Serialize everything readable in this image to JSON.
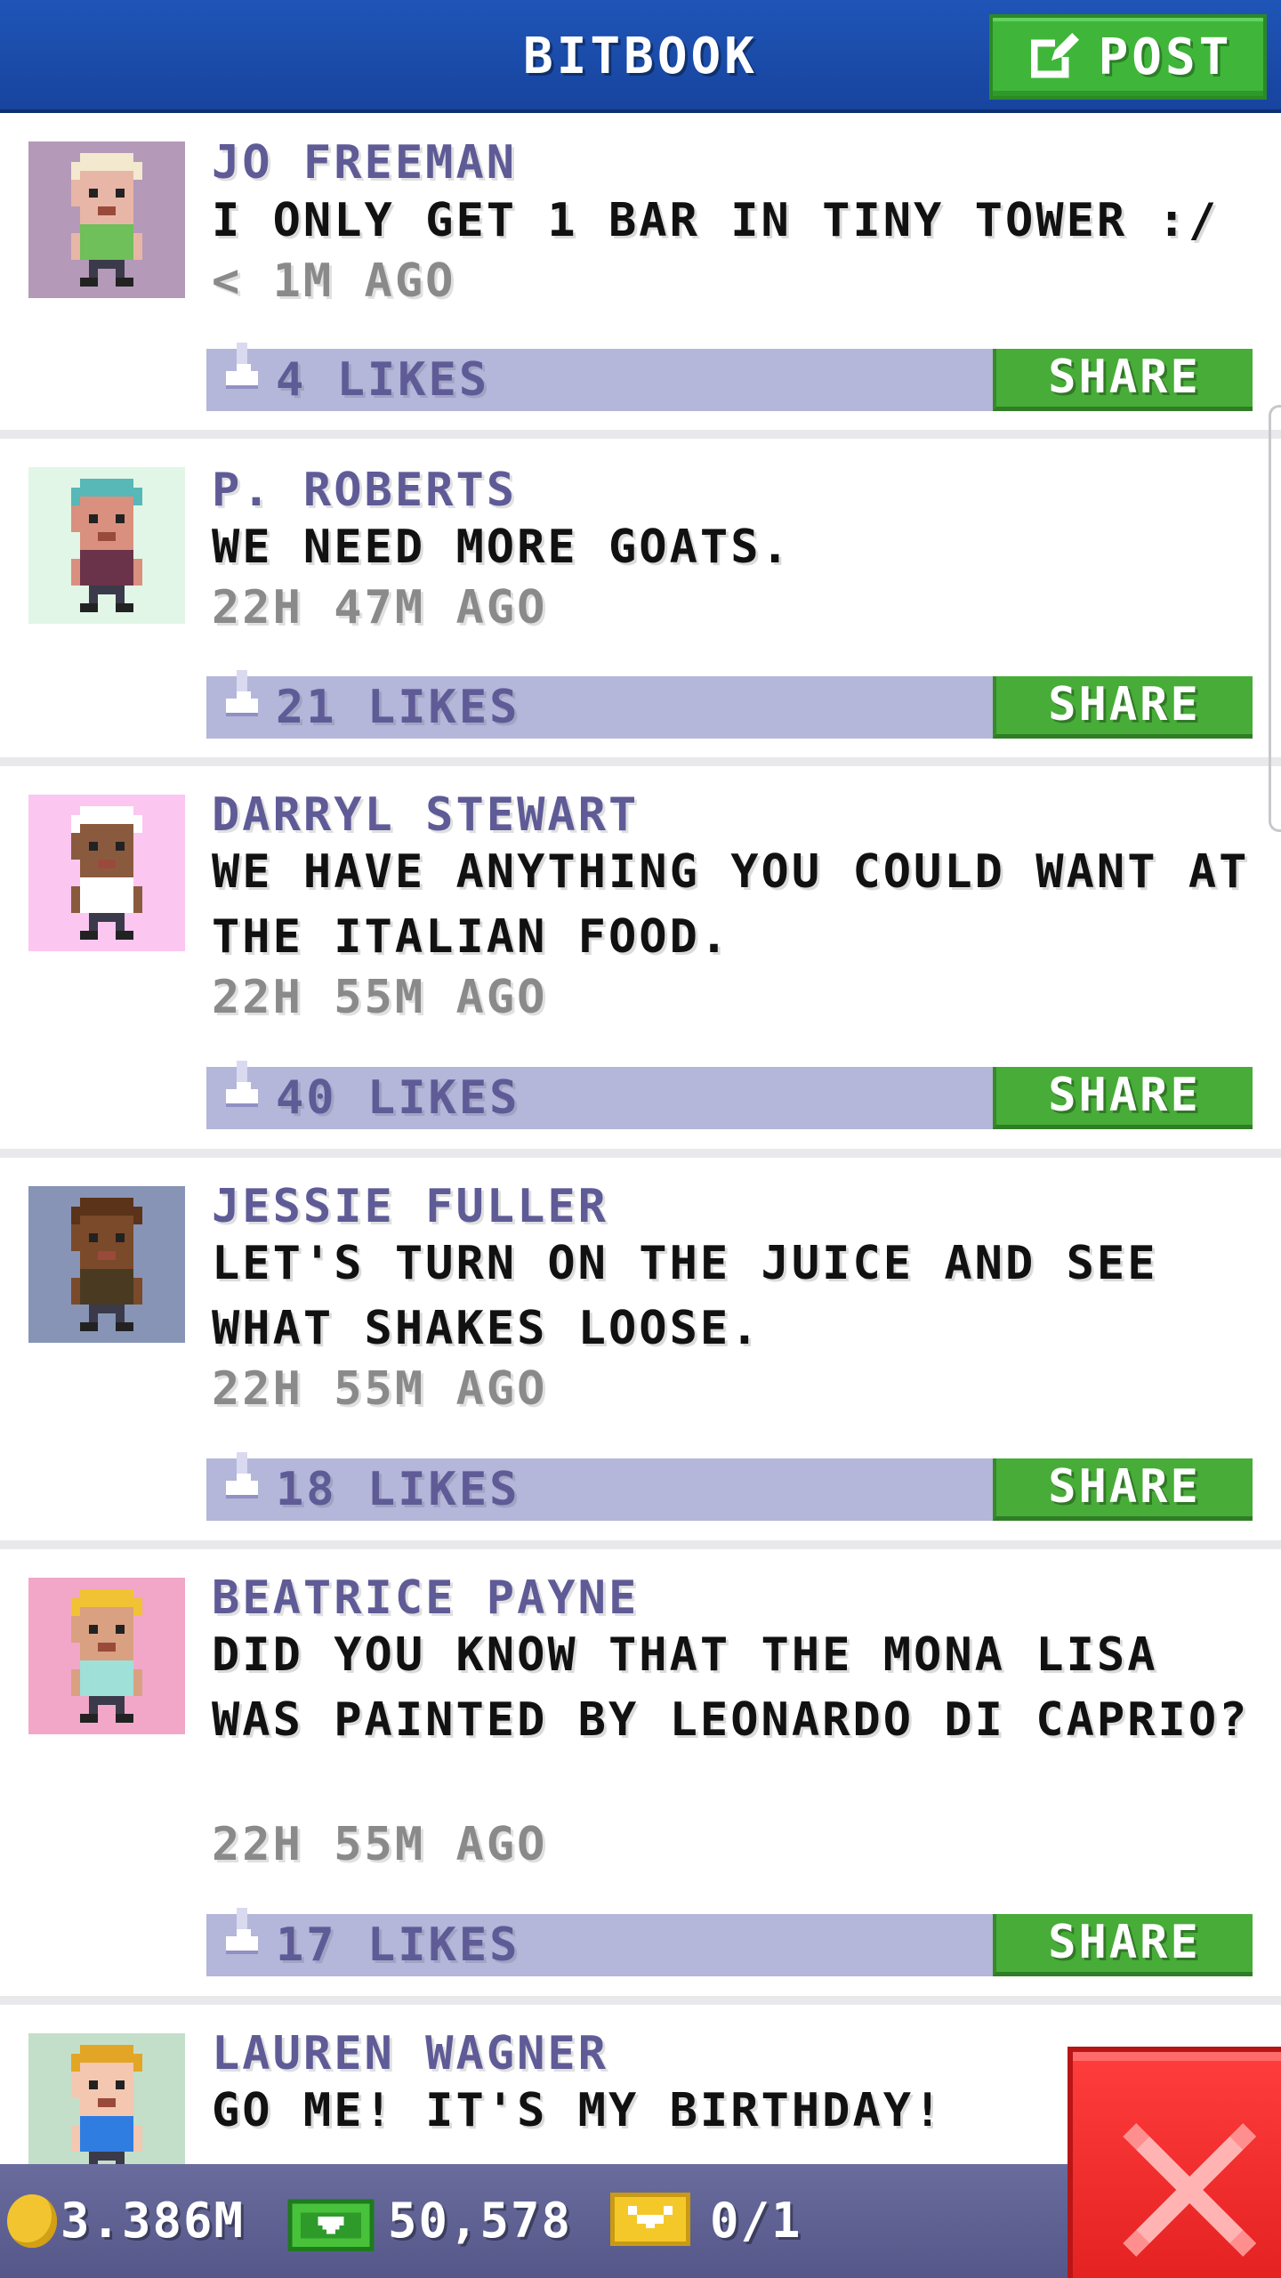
{
  "header": {
    "title": "BITBOOK",
    "post_label": "POST"
  },
  "posts": [
    {
      "author": "JO FREEMAN",
      "message": "I ONLY GET 1 BAR IN TINY TOWER :/",
      "time": "< 1M AGO",
      "likes": "4 LIKES",
      "share_label": "SHARE",
      "avatar_bg": "#b499b8",
      "skin": "#e8b6a6",
      "hair": "#f2e9cf",
      "shirt": "#6fbf5a"
    },
    {
      "author": "P. ROBERTS",
      "message": "WE NEED MORE GOATS.",
      "time": "22H 47M AGO",
      "likes": "21 LIKES",
      "share_label": "SHARE",
      "avatar_bg": "#e1f6e6",
      "skin": "#d9907f",
      "hair": "#58b7b7",
      "shirt": "#6b3349"
    },
    {
      "author": "DARRYL STEWART",
      "message": "WE HAVE ANYTHING YOU COULD WANT AT THE ITALIAN FOOD.",
      "time": "22H 55M AGO",
      "likes": "40 LIKES",
      "share_label": "SHARE",
      "avatar_bg": "#fbc6f0",
      "skin": "#8a5a3f",
      "hair": "#ffffff",
      "shirt": "#ffffff"
    },
    {
      "author": "JESSIE FULLER",
      "message": "LET'S TURN ON THE JUICE AND SEE WHAT SHAKES LOOSE.",
      "time": "22H 55M AGO",
      "likes": "18 LIKES",
      "share_label": "SHARE",
      "avatar_bg": "#8794b6",
      "skin": "#7a4a2a",
      "hair": "#5a3318",
      "shirt": "#4a3a22"
    },
    {
      "author": "BEATRICE PAYNE",
      "message": "DID YOU KNOW THAT THE MONA LISA WAS PAINTED BY LEONARDO DI CAPRIO?",
      "time": "22H 55M AGO",
      "likes": "17 LIKES",
      "share_label": "SHARE",
      "avatar_bg": "#f2a7c8",
      "skin": "#d9a181",
      "hair": "#f0c234",
      "shirt": "#9fe0d8"
    },
    {
      "author": "LAUREN WAGNER",
      "message": "GO ME! IT'S MY BIRTHDAY!",
      "time": "",
      "likes": "",
      "share_label": "",
      "avatar_bg": "#c3dfca",
      "skin": "#f4c7b0",
      "hair": "#e3a525",
      "shirt": "#2f7de0"
    }
  ],
  "status_bar": {
    "coins": "3.386M",
    "cash": "50,578",
    "bux": "0/1"
  },
  "icons": {
    "post": "edit-icon",
    "like": "thumbs-up-icon",
    "coin": "coin-icon",
    "cash": "cash-icon",
    "bux": "ticket-icon",
    "close": "close-icon"
  }
}
